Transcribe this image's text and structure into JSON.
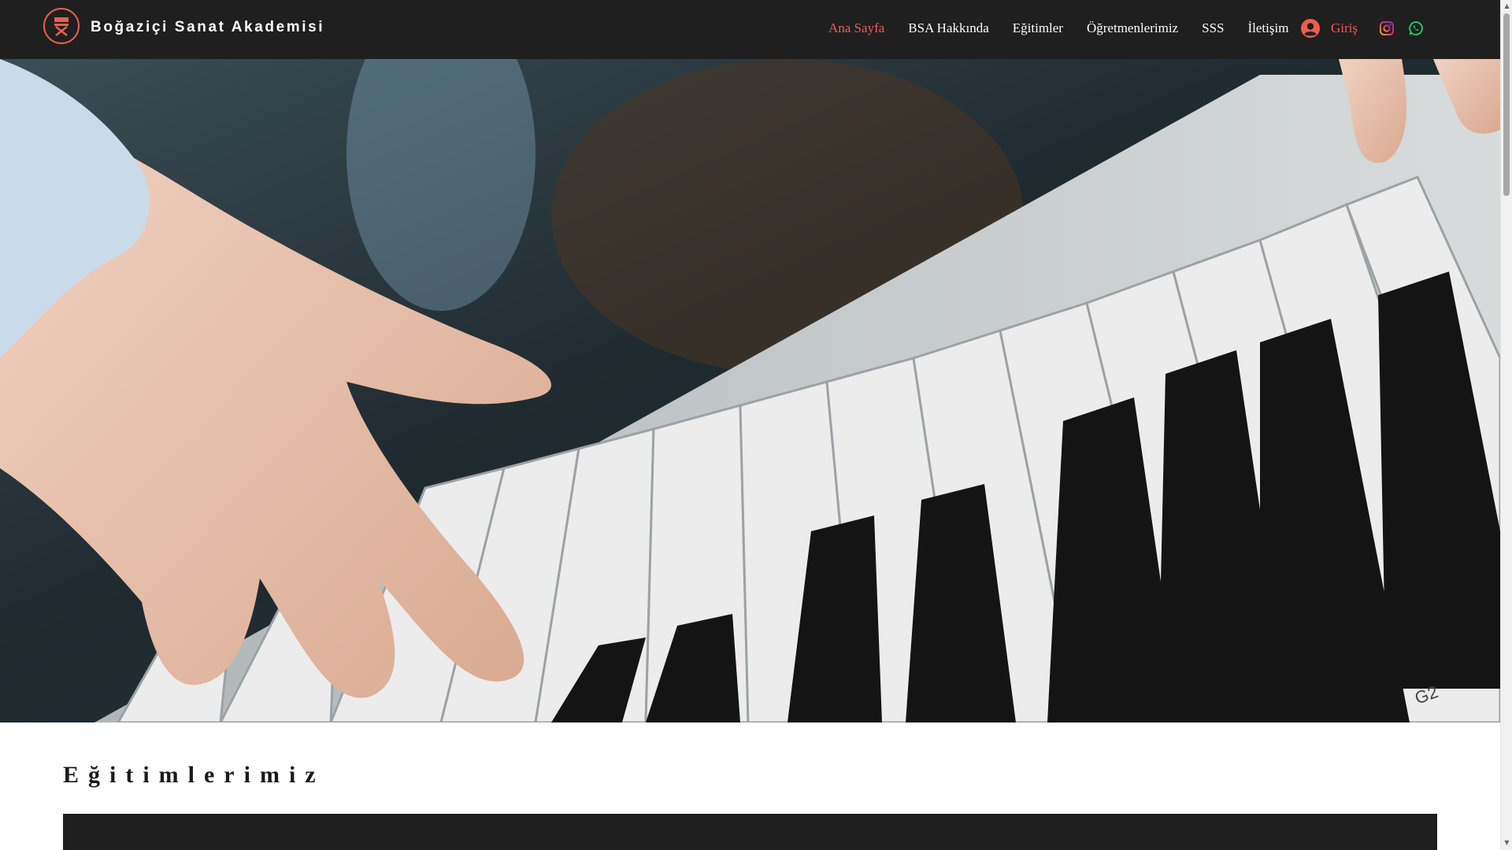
{
  "header": {
    "brand": "Boğaziçi Sanat Akademisi",
    "nav": [
      {
        "label": "Ana Sayfa",
        "active": true
      },
      {
        "label": "BSA Hakkında",
        "active": false
      },
      {
        "label": "Eğitimler",
        "active": false
      },
      {
        "label": "Öğretmenlerimiz",
        "active": false
      },
      {
        "label": "SSS",
        "active": false
      },
      {
        "label": "İletişim",
        "active": false
      }
    ],
    "login_label": "Giriş",
    "social": [
      "instagram-icon",
      "whatsapp-icon"
    ]
  },
  "colors": {
    "accent": "#e8604c",
    "header_bg": "#1f1f1f"
  },
  "section": {
    "title": "Eğitimlerimiz"
  }
}
